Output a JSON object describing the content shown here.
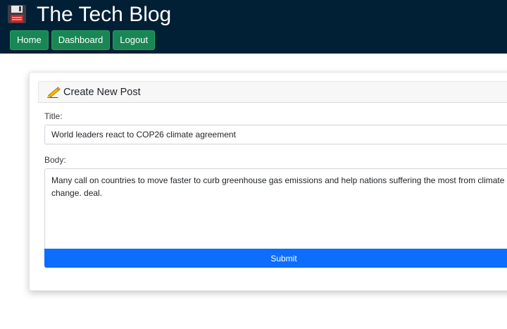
{
  "header": {
    "site_title": "The Tech Blog",
    "logo_icon": "floppy-disk-icon",
    "nav": [
      {
        "label": "Home"
      },
      {
        "label": "Dashboard"
      },
      {
        "label": "Logout"
      }
    ]
  },
  "form": {
    "heading": "Create New Post",
    "heading_icon": "pencil-writing-icon",
    "title_label": "Title:",
    "title_value": "World leaders react to COP26 climate agreement",
    "body_label": "Body:",
    "body_value": "Many call on countries to move faster to curb greenhouse gas emissions and help nations suffering the most from climate change. deal.",
    "submit_label": "Submit"
  },
  "colors": {
    "header_bg": "#011f35",
    "nav_button": "#198754",
    "submit_button": "#0d6efd"
  }
}
